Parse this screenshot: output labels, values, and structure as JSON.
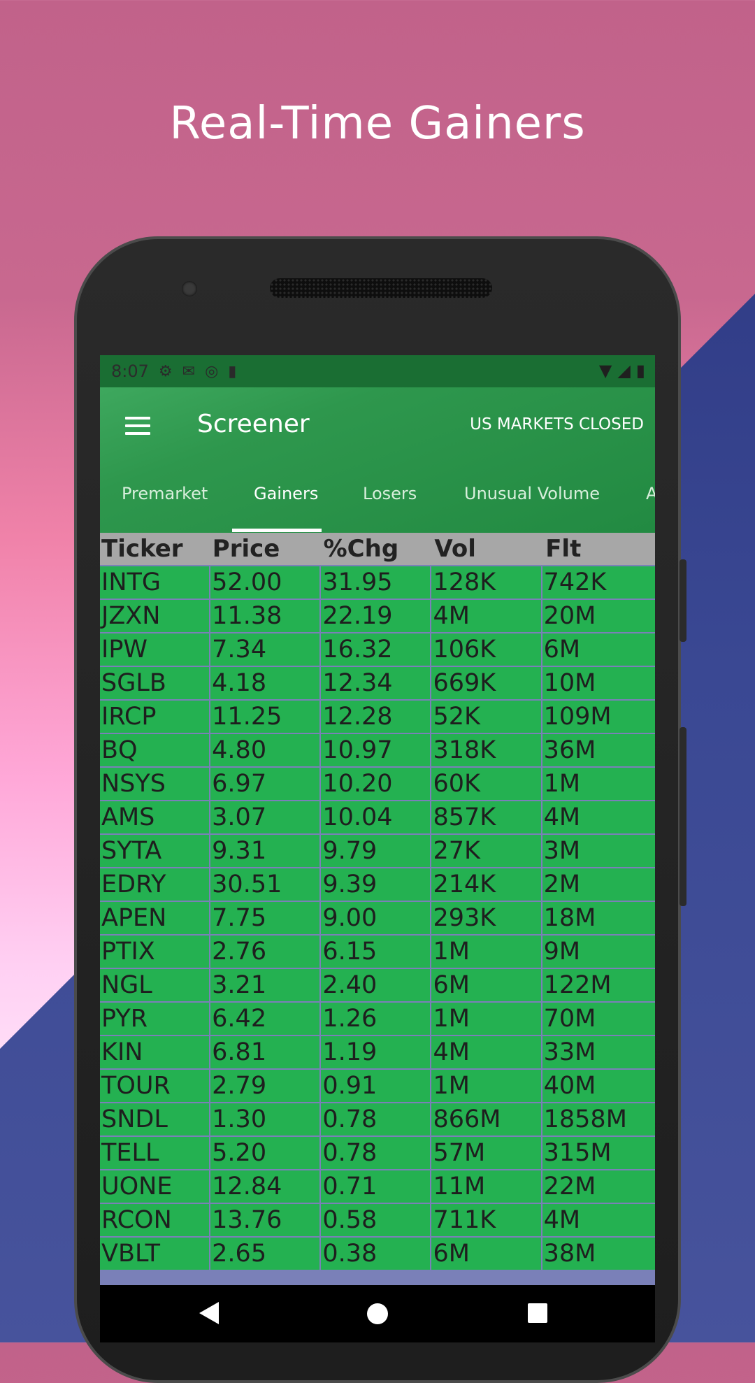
{
  "promo": {
    "headline": "Real-Time Gainers"
  },
  "status_bar": {
    "time": "8:07"
  },
  "app_bar": {
    "title": "Screener",
    "market_status": "US MARKETS CLOSED"
  },
  "tabs": [
    {
      "label": "Premarket"
    },
    {
      "label": "Gainers"
    },
    {
      "label": "Losers"
    },
    {
      "label": "Unusual Volume"
    },
    {
      "label": "A"
    }
  ],
  "active_tab": "Gainers",
  "table": {
    "columns": [
      "Ticker",
      "Price",
      "%Chg",
      "Vol",
      "Flt"
    ],
    "rows": [
      [
        "INTG",
        "52.00",
        "31.95",
        "128K",
        "742K"
      ],
      [
        "JZXN",
        "11.38",
        "22.19",
        "4M",
        "20M"
      ],
      [
        "IPW",
        "7.34",
        "16.32",
        "106K",
        "6M"
      ],
      [
        "SGLB",
        "4.18",
        "12.34",
        "669K",
        "10M"
      ],
      [
        "IRCP",
        "11.25",
        "12.28",
        "52K",
        "109M"
      ],
      [
        "BQ",
        "4.80",
        "10.97",
        "318K",
        "36M"
      ],
      [
        "NSYS",
        "6.97",
        "10.20",
        "60K",
        "1M"
      ],
      [
        "AMS",
        "3.07",
        "10.04",
        "857K",
        "4M"
      ],
      [
        "SYTA",
        "9.31",
        "9.79",
        "27K",
        "3M"
      ],
      [
        "EDRY",
        "30.51",
        "9.39",
        "214K",
        "2M"
      ],
      [
        "APEN",
        "7.75",
        "9.00",
        "293K",
        "18M"
      ],
      [
        "PTIX",
        "2.76",
        "6.15",
        "1M",
        "9M"
      ],
      [
        "NGL",
        "3.21",
        "2.40",
        "6M",
        "122M"
      ],
      [
        "PYR",
        "6.42",
        "1.26",
        "1M",
        "70M"
      ],
      [
        "KIN",
        "6.81",
        "1.19",
        "4M",
        "33M"
      ],
      [
        "TOUR",
        "2.79",
        "0.91",
        "1M",
        "40M"
      ],
      [
        "SNDL",
        "1.30",
        "0.78",
        "866M",
        "1858M"
      ],
      [
        "TELL",
        "5.20",
        "0.78",
        "57M",
        "315M"
      ],
      [
        "UONE",
        "12.84",
        "0.71",
        "11M",
        "22M"
      ],
      [
        "RCON",
        "13.76",
        "0.58",
        "711K",
        "4M"
      ],
      [
        "VBLT",
        "2.65",
        "0.38",
        "6M",
        "38M"
      ]
    ]
  },
  "colors": {
    "app_green": "#228a42",
    "cell_green": "#24b151",
    "header_gray": "#a7a7a7",
    "grid_line": "#7a80b8"
  }
}
